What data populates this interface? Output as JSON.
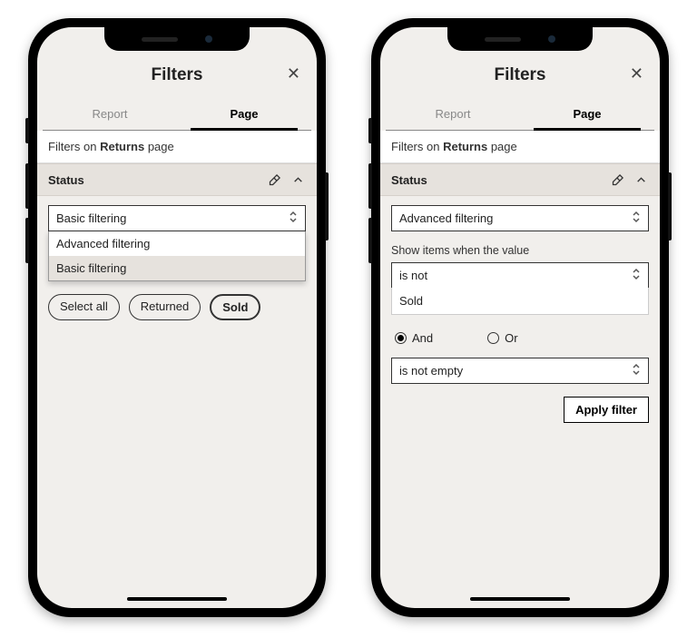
{
  "header": {
    "title": "Filters",
    "close": "✕"
  },
  "tabs": {
    "report": "Report",
    "page": "Page"
  },
  "subheader": {
    "prefix": "Filters on ",
    "pageName": "Returns",
    "suffix": " page"
  },
  "section": {
    "title": "Status"
  },
  "left": {
    "selectValue": "Basic filtering",
    "options": {
      "advanced": "Advanced filtering",
      "basic": "Basic filtering"
    },
    "chips": {
      "selectAll": "Select all",
      "returned": "Returned",
      "sold": "Sold"
    }
  },
  "right": {
    "selectValue": "Advanced filtering",
    "showLabel": "Show items when the value",
    "cond1": "is not",
    "val1": "Sold",
    "radios": {
      "and": "And",
      "or": "Or"
    },
    "cond2": "is not empty",
    "apply": "Apply filter"
  }
}
